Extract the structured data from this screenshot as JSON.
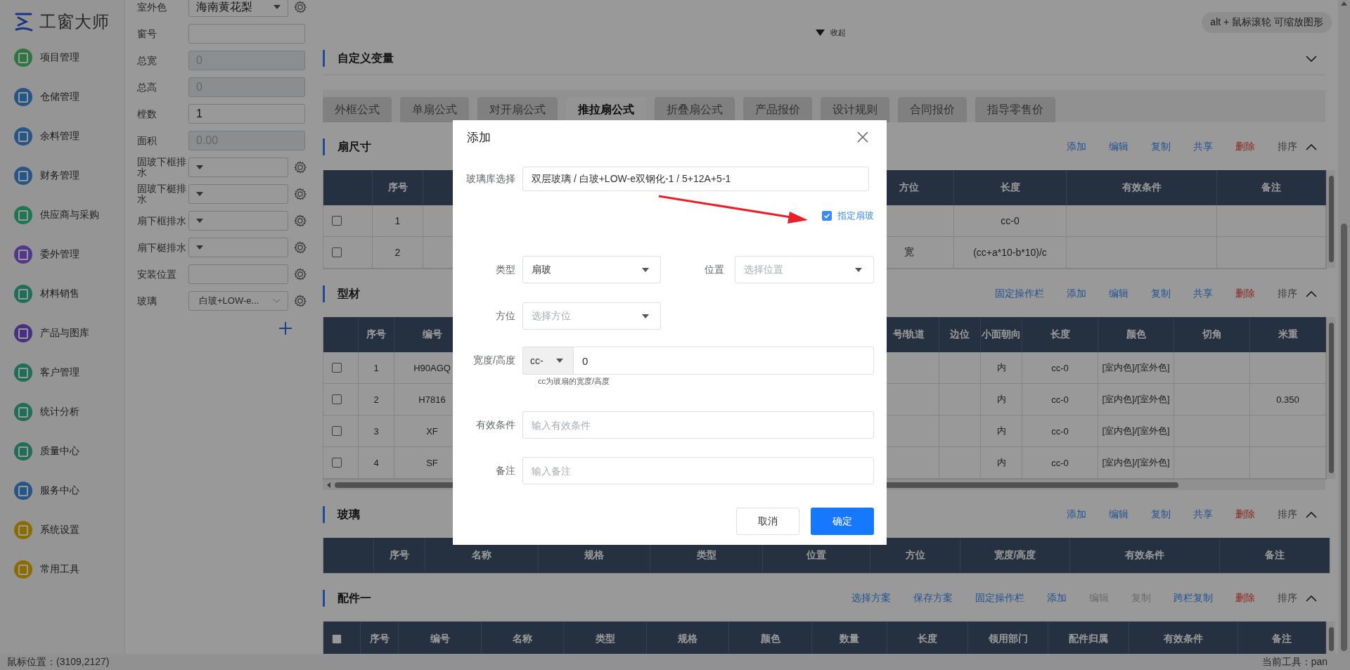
{
  "app": {
    "logo": "工窗大师"
  },
  "sidebar": {
    "items": [
      {
        "label": "项目管理",
        "color": "#2e7541"
      },
      {
        "label": "仓储管理",
        "color": "#255686"
      },
      {
        "label": "余料管理",
        "color": "#255686"
      },
      {
        "label": "财务管理",
        "color": "#255686"
      },
      {
        "label": "供应商与采购",
        "color": "#1f7556"
      },
      {
        "label": "委外管理",
        "color": "#53378a"
      },
      {
        "label": "材料销售",
        "color": "#1f6e56"
      },
      {
        "label": "产品与图库",
        "color": "#493182"
      },
      {
        "label": "客户管理",
        "color": "#1f6e56"
      },
      {
        "label": "统计分析",
        "color": "#1f6e56"
      },
      {
        "label": "质量中心",
        "color": "#1f6e56"
      },
      {
        "label": "服务中心",
        "color": "#255686"
      },
      {
        "label": "系统设置",
        "color": "#8b6c00"
      },
      {
        "label": "常用工具",
        "color": "#8b6c00"
      }
    ]
  },
  "form": {
    "fields": [
      {
        "label": "室外色",
        "kind": "select",
        "value": "海南黄花梨",
        "gear": true,
        "disabled": false
      },
      {
        "label": "窗号",
        "kind": "input",
        "gear": false,
        "disabled": false
      },
      {
        "label": "总宽",
        "kind": "input",
        "value": "0",
        "gear": false,
        "disabled": true
      },
      {
        "label": "总高",
        "kind": "input",
        "value": "0",
        "gear": false,
        "disabled": true
      },
      {
        "label": "樘数",
        "kind": "input",
        "value": "1",
        "gear": false,
        "disabled": false
      },
      {
        "label": "面积",
        "kind": "input",
        "value": "0.00",
        "gear": false,
        "disabled": true
      },
      {
        "label": "固玻下框排水",
        "kind": "select",
        "gear": true,
        "disabled": false
      },
      {
        "label": "固玻下梃排水",
        "kind": "select",
        "gear": true,
        "disabled": false
      },
      {
        "label": "扇下框排水",
        "kind": "select",
        "gear": true,
        "disabled": false
      },
      {
        "label": "扇下梃排水",
        "kind": "select",
        "gear": true,
        "disabled": false
      },
      {
        "label": "安装位置",
        "kind": "input",
        "gear": true,
        "disabled": false
      },
      {
        "label": "玻璃",
        "kind": "cascader",
        "value": "白玻+LOW-e...",
        "gear": true,
        "disabled": false
      }
    ]
  },
  "main": {
    "collapse_toggle": "收起",
    "hint": "alt + 鼠标滚轮 可缩放图形"
  },
  "custom_variables": {
    "title": "自定义变量",
    "expanded": false
  },
  "tabs": [
    {
      "label": "外框公式",
      "selected": false
    },
    {
      "label": "单扇公式",
      "selected": false
    },
    {
      "label": "对开扇公式",
      "selected": false
    },
    {
      "label": "推拉扇公式",
      "selected": true
    },
    {
      "label": "折叠扇公式",
      "selected": false
    },
    {
      "label": "产品报价",
      "selected": false
    },
    {
      "label": "设计规则",
      "selected": false
    },
    {
      "label": "合同报价",
      "selected": false
    },
    {
      "label": "指导零售价",
      "selected": false
    }
  ],
  "sections": [
    {
      "title": "扇尺寸",
      "expanded": true,
      "actions": [
        {
          "label": "添加",
          "kind": "link"
        },
        {
          "label": "编辑",
          "kind": "link"
        },
        {
          "label": "复制",
          "kind": "link"
        },
        {
          "label": "共享",
          "kind": "link"
        },
        {
          "label": "删除",
          "kind": "danger"
        },
        {
          "label": "排序",
          "kind": "plain"
        }
      ],
      "table": {
        "columns": [
          {
            "kind": "text",
            "label": "序号"
          },
          {
            "kind": "blank"
          },
          {
            "kind": "text",
            "label": "方位"
          },
          {
            "kind": "text",
            "label": "长度"
          },
          {
            "kind": "text",
            "label": "有效条件"
          },
          {
            "kind": "text",
            "label": "备注"
          }
        ],
        "rows": [
          {
            "checked": false,
            "cells": [
              "1",
              "",
              "",
              "cc-0",
              "",
              ""
            ]
          },
          {
            "checked": false,
            "cells": [
              "2",
              "",
              "宽",
              "(cc+a*10-b*10)/c",
              "",
              ""
            ]
          }
        ]
      }
    },
    {
      "title": "型材",
      "expanded": true,
      "actions": [
        {
          "label": "固定操作栏",
          "kind": "link"
        },
        {
          "label": "添加",
          "kind": "link"
        },
        {
          "label": "编辑",
          "kind": "link"
        },
        {
          "label": "复制",
          "kind": "link"
        },
        {
          "label": "共享",
          "kind": "link"
        },
        {
          "label": "删除",
          "kind": "danger"
        },
        {
          "label": "排序",
          "kind": "plain"
        }
      ],
      "table": {
        "columns": [
          {
            "kind": "text",
            "label": "序号"
          },
          {
            "kind": "text",
            "label": "编号"
          },
          {
            "kind": "blank"
          },
          {
            "kind": "text",
            "label": "号/轨道"
          },
          {
            "kind": "text",
            "label": "边位"
          },
          {
            "kind": "text",
            "label": "小面朝向"
          },
          {
            "kind": "text",
            "label": "长度"
          },
          {
            "kind": "text",
            "label": "颜色"
          },
          {
            "kind": "text",
            "label": "切角"
          },
          {
            "kind": "text",
            "label": "米重"
          }
        ],
        "rows": [
          {
            "checked": false,
            "cells": [
              "1",
              "H90AGQ",
              "",
              "",
              "",
              "内",
              "cc-0",
              "[室内色]/[室外色]",
              "",
              ""
            ]
          },
          {
            "checked": false,
            "cells": [
              "2",
              "H7816",
              "",
              "",
              "",
              "内",
              "cc-0",
              "[室内色]/[室外色]",
              "",
              "0.350"
            ]
          },
          {
            "checked": false,
            "cells": [
              "3",
              "XF",
              "",
              "",
              "",
              "内",
              "cc-0",
              "[室内色]/[室外色]",
              "",
              ""
            ]
          },
          {
            "checked": false,
            "cells": [
              "4",
              "SF",
              "",
              "",
              "",
              "内",
              "cc-0",
              "[室内色]/[室外色]",
              "",
              ""
            ]
          }
        ]
      }
    },
    {
      "title": "玻璃",
      "expanded": true,
      "actions": [
        {
          "label": "添加",
          "kind": "link"
        },
        {
          "label": "编辑",
          "kind": "link"
        },
        {
          "label": "复制",
          "kind": "link"
        },
        {
          "label": "共享",
          "kind": "link"
        },
        {
          "label": "删除",
          "kind": "danger"
        },
        {
          "label": "排序",
          "kind": "plain"
        }
      ],
      "table": {
        "columns": [
          {
            "kind": "text",
            "label": "序号"
          },
          {
            "kind": "text",
            "label": "名称"
          },
          {
            "kind": "text",
            "label": "规格"
          },
          {
            "kind": "text",
            "label": "类型"
          },
          {
            "kind": "text",
            "label": "位置"
          },
          {
            "kind": "text",
            "label": "方位"
          },
          {
            "kind": "text",
            "label": "宽度/高度"
          },
          {
            "kind": "text",
            "label": "有效条件"
          },
          {
            "kind": "text",
            "label": "备注"
          }
        ]
      }
    },
    {
      "title": "配件一",
      "expanded": true,
      "actions": [
        {
          "label": "选择方案",
          "kind": "link"
        },
        {
          "label": "保存方案",
          "kind": "link"
        },
        {
          "label": "固定操作栏",
          "kind": "link"
        },
        {
          "label": "添加",
          "kind": "link"
        },
        {
          "label": "编辑",
          "kind": "disabled"
        },
        {
          "label": "复制",
          "kind": "disabled"
        },
        {
          "label": "跨栏复制",
          "kind": "link"
        },
        {
          "label": "删除",
          "kind": "danger"
        },
        {
          "label": "排序",
          "kind": "plain"
        }
      ],
      "table": {
        "select_all": {
          "checked": false
        },
        "columns": [
          {
            "kind": "text",
            "label": "序号"
          },
          {
            "kind": "text",
            "label": "编号"
          },
          {
            "kind": "text",
            "label": "名称"
          },
          {
            "kind": "text",
            "label": "类型"
          },
          {
            "kind": "text",
            "label": "规格"
          },
          {
            "kind": "text",
            "label": "颜色"
          },
          {
            "kind": "text",
            "label": "数量"
          },
          {
            "kind": "text",
            "label": "长度"
          },
          {
            "kind": "text",
            "label": "领用部门"
          },
          {
            "kind": "text",
            "label": "配件归属"
          },
          {
            "kind": "text",
            "label": "有效条件"
          },
          {
            "kind": "text",
            "label": "备注"
          }
        ]
      }
    }
  ],
  "status_bar": {
    "mouse_position": "鼠标位置：(3109,2127)",
    "current_tool": "当前工具：pan"
  },
  "dialog": {
    "title": "添加",
    "glass_library": {
      "label": "玻璃库选择",
      "value": "双层玻璃 / 白玻+LOW-e双钢化-1 / 5+12A+5-1"
    },
    "sash_glass": {
      "label": "指定扇玻",
      "checked": true
    },
    "type": {
      "label": "类型",
      "value": "扇玻"
    },
    "position": {
      "label": "位置",
      "placeholder": "选择位置"
    },
    "orientation": {
      "label": "方位",
      "placeholder": "选择方位"
    },
    "size": {
      "label": "宽度/高度",
      "prefix": "cc-",
      "value": "0",
      "hint": "cc为玻扇的宽度/高度"
    },
    "condition": {
      "label": "有效条件",
      "placeholder": "输入有效条件"
    },
    "remark": {
      "label": "备注",
      "placeholder": "输入备注"
    },
    "buttons": [
      {
        "label": "取消",
        "kind": "default"
      },
      {
        "label": "确定",
        "kind": "primary"
      }
    ]
  }
}
